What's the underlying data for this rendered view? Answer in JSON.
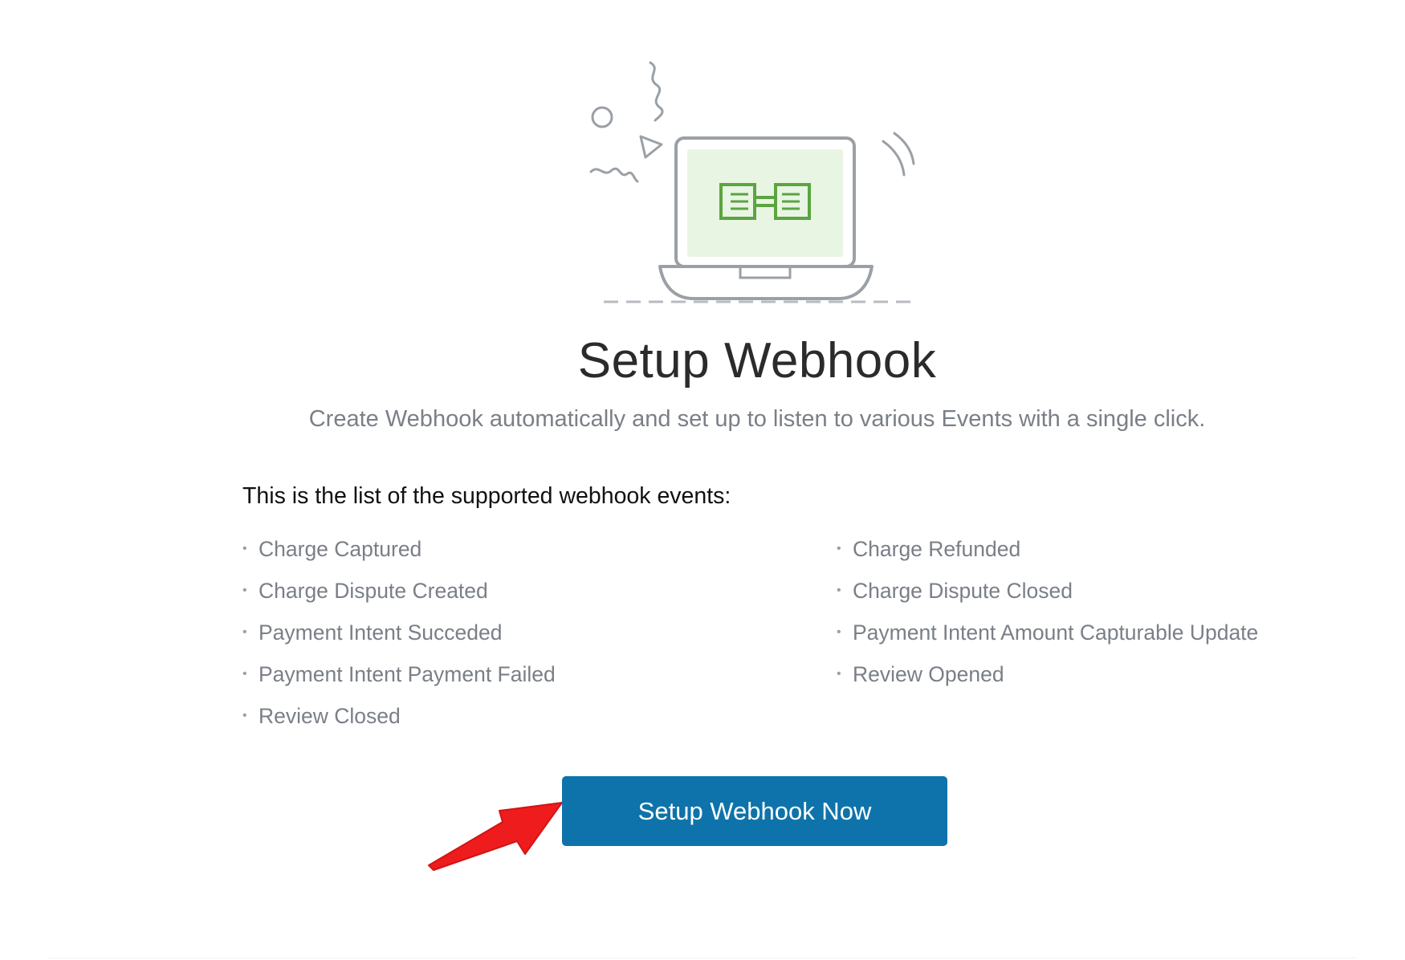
{
  "header": {
    "title": "Setup Webhook",
    "subtitle": "Create Webhook automatically and set up to listen to various Events with a single click."
  },
  "events": {
    "heading": "This is the list of the supported webhook events:",
    "bullet": "•",
    "left_column": [
      "Charge Captured",
      "Charge Dispute Created",
      "Payment Intent Succeded",
      "Payment Intent Payment Failed",
      "Review Closed"
    ],
    "right_column": [
      "Charge Refunded",
      "Charge Dispute Closed",
      "Payment Intent Amount Capturable Update",
      "Review Opened"
    ]
  },
  "action": {
    "button_label": "Setup Webhook Now"
  },
  "icons": {
    "illustration": "laptop-webhook-illustration",
    "pointer": "red-arrow-icon"
  },
  "colors": {
    "button_bg": "#0e73aa",
    "button_text": "#ffffff",
    "accent_green": "#5aa540",
    "screen_green": "#e9f5e3",
    "arrow_red": "#ee1c1c",
    "muted_text": "#7a7f87"
  }
}
